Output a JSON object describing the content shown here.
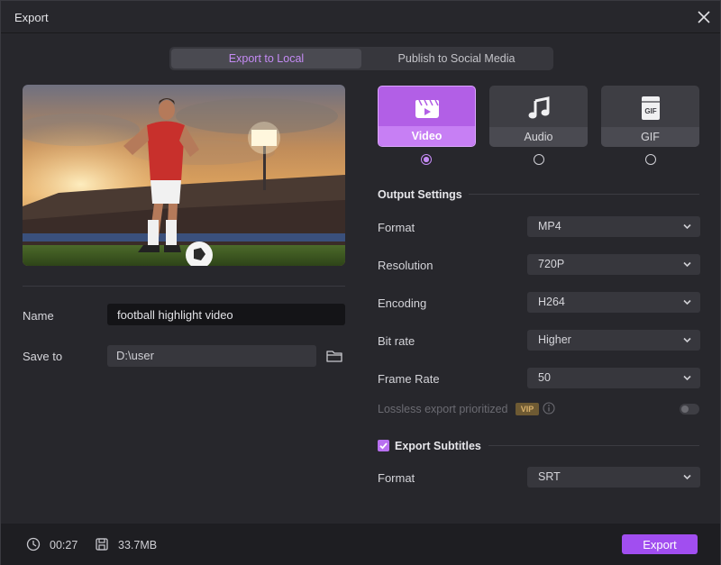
{
  "window": {
    "title": "Export"
  },
  "tabs": [
    {
      "label": "Export to Local",
      "active": true
    },
    {
      "label": "Publish to Social Media",
      "active": false
    }
  ],
  "left": {
    "name_label": "Name",
    "name_value": "football highlight video",
    "save_label": "Save to",
    "save_path": "D:\\user"
  },
  "types": [
    {
      "label": "Video",
      "icon": "clapperboard-icon",
      "selected": true
    },
    {
      "label": "Audio",
      "icon": "music-note-icon",
      "selected": false
    },
    {
      "label": "GIF",
      "icon": "gif-icon",
      "selected": false
    }
  ],
  "output": {
    "title": "Output Settings",
    "rows": [
      {
        "label": "Format",
        "value": "MP4"
      },
      {
        "label": "Resolution",
        "value": "720P"
      },
      {
        "label": "Encoding",
        "value": "H264"
      },
      {
        "label": "Bit rate",
        "value": "Higher"
      },
      {
        "label": "Frame Rate",
        "value": "50"
      }
    ],
    "lossless_label": "Lossless export prioritized",
    "vip_badge": "VIP"
  },
  "subtitles": {
    "title": "Export Subtitles",
    "checked": true,
    "format_label": "Format",
    "format_value": "SRT"
  },
  "footer": {
    "duration": "00:27",
    "size": "33.7MB",
    "export_label": "Export"
  },
  "colors": {
    "accent": "#c58bf5",
    "button": "#a14ef0",
    "background": "#27272c"
  }
}
